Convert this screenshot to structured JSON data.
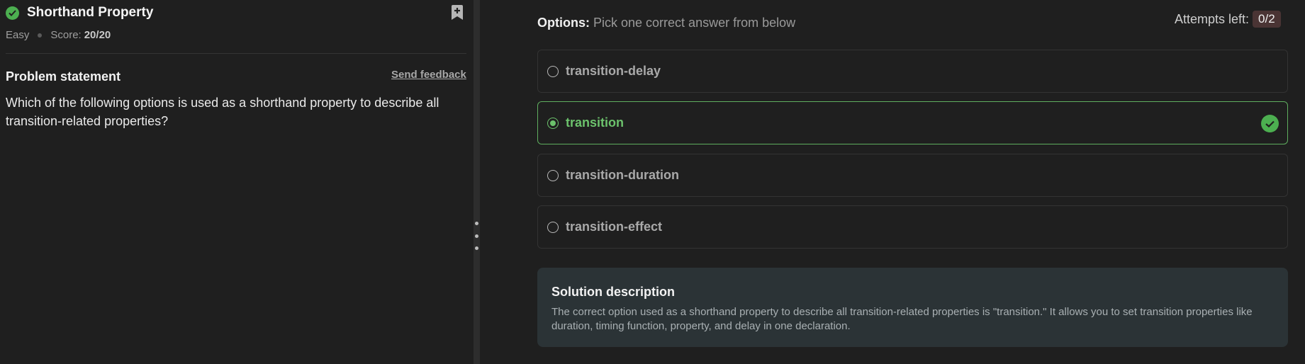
{
  "problem": {
    "title": "Shorthand Property",
    "difficulty": "Easy",
    "score_label": "Score:",
    "score_value": "20/20",
    "statement_title": "Problem statement",
    "feedback_label": "Send feedback",
    "statement_text": "Which of the following options is used as a shorthand property to describe all transition-related properties?"
  },
  "options_panel": {
    "heading_bold": "Options:",
    "heading_rest": " Pick one correct answer from below",
    "attempts_label": "Attempts left:",
    "attempts_value": "0/2",
    "options": [
      {
        "label": "transition-delay",
        "selected": false
      },
      {
        "label": "transition",
        "selected": true,
        "correct": true
      },
      {
        "label": "transition-duration",
        "selected": false
      },
      {
        "label": "transition-effect",
        "selected": false
      }
    ]
  },
  "solution": {
    "title": "Solution description",
    "text": "The correct option used as a shorthand property to describe all transition-related properties is \"transition.\" It allows you to set transition properties like duration, timing function, property, and delay in one declaration."
  },
  "colors": {
    "accent_green": "#6cc26c",
    "background": "#1f1f1f",
    "solution_bg": "#2b3336",
    "attempts_badge_bg": "#4a3434"
  },
  "icons": [
    "check-circle-icon",
    "bookmark-add-icon",
    "radio-icon",
    "splitter-handle-icon"
  ]
}
